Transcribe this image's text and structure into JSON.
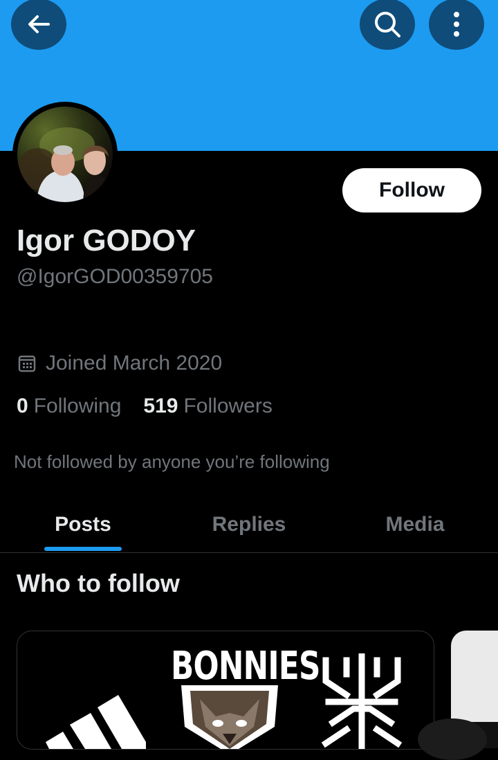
{
  "header": {
    "back_icon": "arrow-left-icon",
    "search_icon": "search-icon",
    "more_icon": "more-vertical-icon",
    "banner_color": "#1d9bf0"
  },
  "profile": {
    "display_name": "Igor GODOY",
    "handle": "@IgorGOD00359705",
    "follow_label": "Follow",
    "joined": "Joined March 2020",
    "following_count": "0",
    "following_label": "Following",
    "followers_count": "519",
    "followers_label": "Followers",
    "not_followed_text": "Not followed by anyone you’re following"
  },
  "tabs": [
    {
      "label": "Posts",
      "active": true
    },
    {
      "label": "Replies",
      "active": false
    },
    {
      "label": "Media",
      "active": false
    }
  ],
  "who_to_follow": {
    "title": "Who to follow",
    "card_logos": [
      "adidas-logo",
      "bonnies-logo",
      "basketball-crest-logo"
    ],
    "bonnies_text": "BONNIES"
  }
}
